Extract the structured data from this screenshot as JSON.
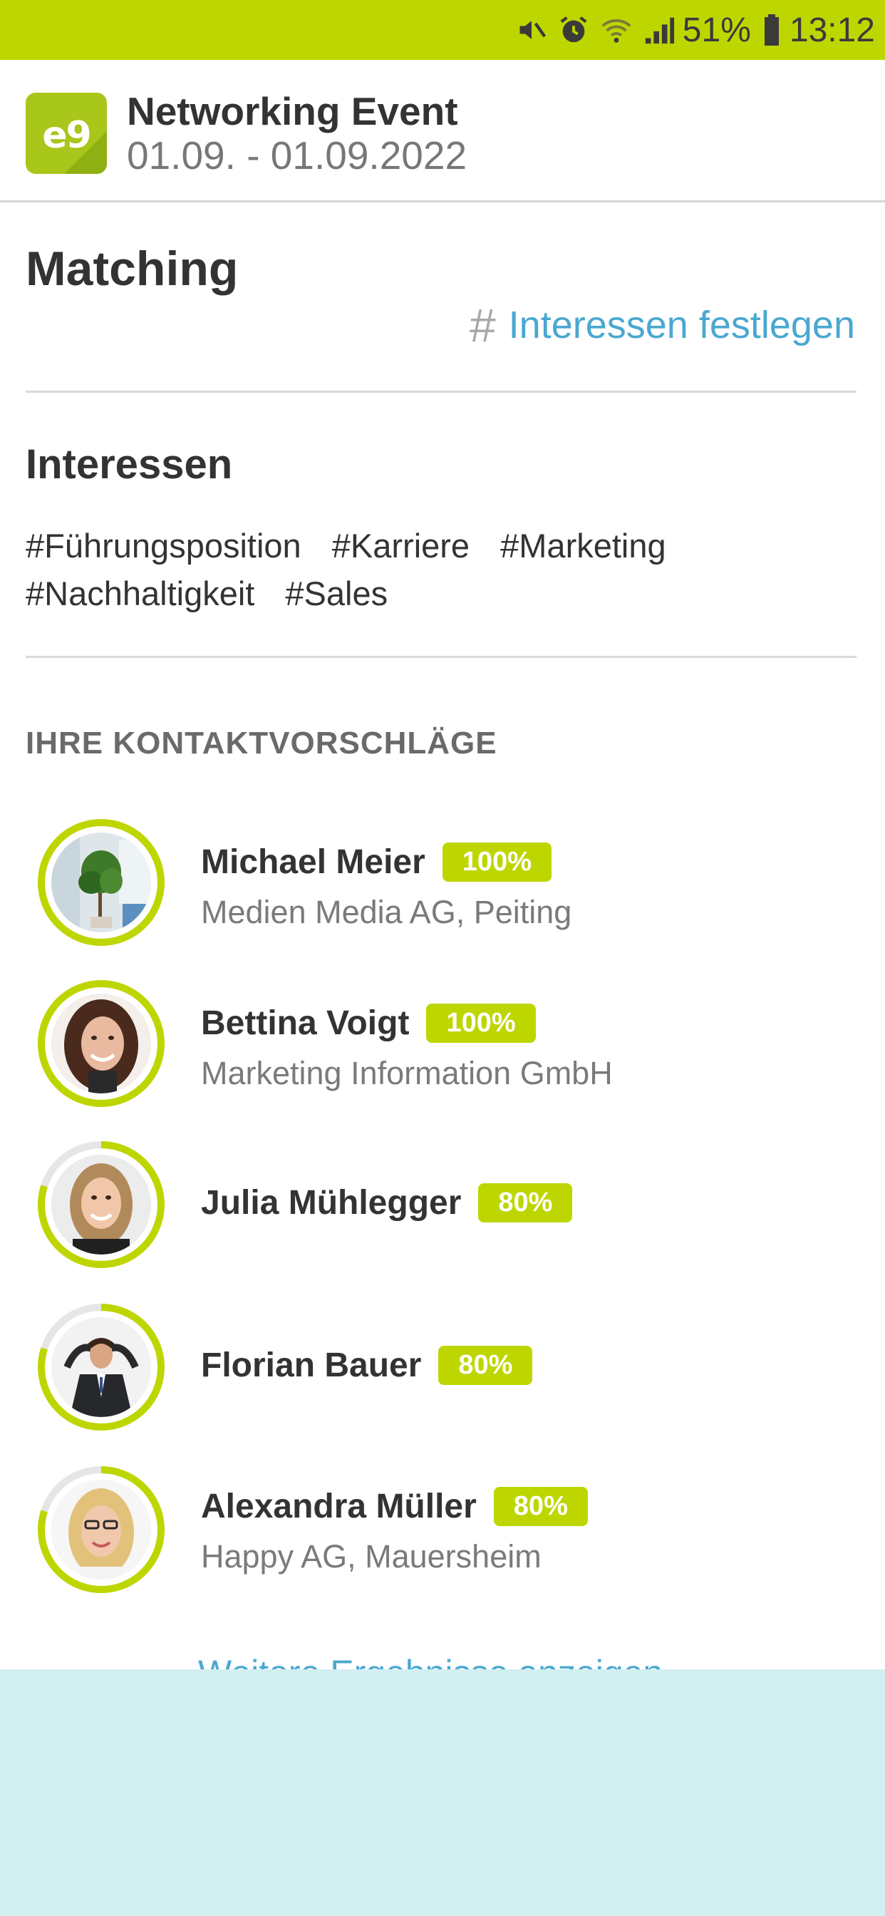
{
  "status_bar": {
    "battery": "51%",
    "time": "13:12",
    "icons": [
      "mute-icon",
      "alarm-icon",
      "wifi-icon",
      "signal-icon",
      "battery-icon"
    ]
  },
  "header": {
    "logo_text": "e9",
    "title": "Networking Event",
    "dates": "01.09. - 01.09.2022"
  },
  "matching": {
    "title": "Matching",
    "link_symbol": "#",
    "link_label": "Interessen festlegen"
  },
  "interests": {
    "heading": "Interessen",
    "tags": [
      "#Führungsposition",
      "#Karriere",
      "#Marketing",
      "#Nachhaltigkeit",
      "#Sales"
    ]
  },
  "suggestions": {
    "heading": "IHRE KONTAKTVORSCHLÄGE",
    "contacts": [
      {
        "name": "Michael Meier",
        "match": "100%",
        "match_value": 1.0,
        "company": "Medien Media AG, Peiting"
      },
      {
        "name": "Bettina Voigt",
        "match": "100%",
        "match_value": 1.0,
        "company": "Marketing Information GmbH"
      },
      {
        "name": "Julia Mühlegger",
        "match": "80%",
        "match_value": 0.8,
        "company": ""
      },
      {
        "name": "Florian Bauer",
        "match": "80%",
        "match_value": 0.8,
        "company": ""
      },
      {
        "name": "Alexandra Müller",
        "match": "80%",
        "match_value": 0.8,
        "company": "Happy AG, Mauersheim"
      }
    ],
    "more_label": "Weitere Ergebnisse anzeigen"
  },
  "colors": {
    "accent": "#bed600",
    "link": "#4aa8d0",
    "overlay": "#d2eff1"
  }
}
